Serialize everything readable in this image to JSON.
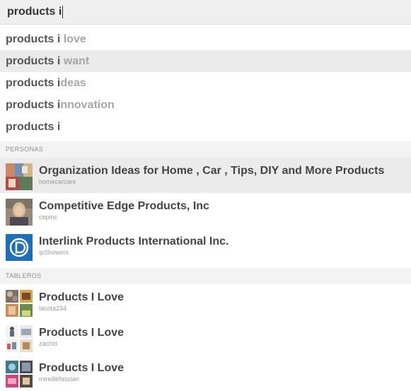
{
  "search": {
    "query": "products i"
  },
  "suggestions": [
    {
      "typed": "products i",
      "rest": " love"
    },
    {
      "typed": "products i",
      "rest": " want"
    },
    {
      "typed": "products i",
      "rest": "deas"
    },
    {
      "typed": "products i",
      "rest": "nnovation"
    },
    {
      "typed": "products i",
      "rest": ""
    }
  ],
  "people": {
    "header": "PERSONAS",
    "items": [
      {
        "title": "Organization Ideas for Home , Car , Tips, DIY and More Products",
        "username": "homecarcare"
      },
      {
        "title": "Competitive Edge Products, Inc",
        "username": "cepinc"
      },
      {
        "title": "Interlink Products International Inc.",
        "username": "ipShowers"
      }
    ]
  },
  "boards": {
    "header": "TABLEROS",
    "items": [
      {
        "title": "Products I Love",
        "username": "lacota234"
      },
      {
        "title": "Products I Love",
        "username": "zachid"
      },
      {
        "title": "Products I Love",
        "username": "mireillefascian"
      }
    ]
  },
  "colors": {
    "highlight": "#ebebeb",
    "section_bg": "#f3f3f3",
    "typed_text": "#555555",
    "completion_text": "#a6a6a6",
    "interlink_brand": "#1c6fb8"
  }
}
